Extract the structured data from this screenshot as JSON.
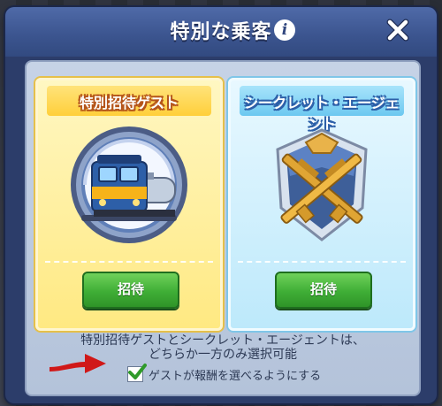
{
  "dialog": {
    "title": "特別な乗客",
    "info_icon": "info-icon",
    "close_icon": "close-icon"
  },
  "cards": [
    {
      "title": "特別招待ゲスト",
      "art_icon": "train-badge-icon",
      "button_label": "招待"
    },
    {
      "title": "シークレット・エージェント",
      "art_icon": "crossed-rifles-badge-icon",
      "button_label": "招待"
    }
  ],
  "note": {
    "line1": "特別招待ゲストとシークレット・エージェントは、",
    "line2": "どちらか一方のみ選択可能"
  },
  "checkbox": {
    "checked": true,
    "label": "ゲストが報酬を選べるようにする"
  },
  "colors": {
    "title_bar": "#3b548e",
    "yellow_card": "#ffe982",
    "blue_card": "#bde9fb",
    "button_green": "#3fae36",
    "arrow_red": "#d01818"
  }
}
